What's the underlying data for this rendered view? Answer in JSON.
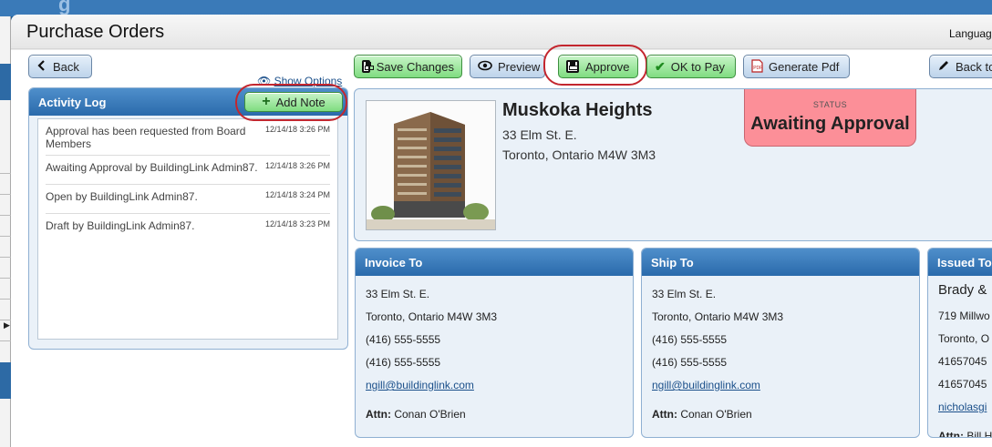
{
  "header": {
    "title": "Purchase Orders",
    "language_label": "Languag"
  },
  "nav": {
    "back_label": "Back",
    "show_options_label": "Show Options"
  },
  "toolbar": {
    "save_label": "Save Changes",
    "preview_label": "Preview",
    "approve_label": "Approve",
    "ok_to_pay_label": "OK to Pay",
    "generate_pdf_label": "Generate Pdf",
    "back_to_label": "Back to"
  },
  "activity_log": {
    "title": "Activity Log",
    "add_note_label": "Add Note",
    "entries": [
      {
        "text": "Approval has been requested from Board Members",
        "time": "12/14/18 3:26 PM"
      },
      {
        "text": "Awaiting Approval by BuildingLink Admin87.",
        "time": "12/14/18 3:26 PM"
      },
      {
        "text": "Open by BuildingLink Admin87.",
        "time": "12/14/18 3:24 PM"
      },
      {
        "text": "Draft by BuildingLink Admin87.",
        "time": "12/14/18 3:23 PM"
      }
    ]
  },
  "property": {
    "name": "Muskoka Heights",
    "address1": "33 Elm St. E.",
    "address2": "Toronto, Ontario M4W 3M3"
  },
  "status": {
    "label": "STATUS",
    "value": "Awaiting Approval",
    "color": "#fc8f98"
  },
  "invoice_to": {
    "title": "Invoice To",
    "address1": "33 Elm St. E.",
    "address2": "Toronto, Ontario M4W 3M3",
    "phone1": "(416) 555-5555",
    "phone2": "(416) 555-5555",
    "email": "ngill@buildinglink.com",
    "attn_label": "Attn:",
    "attn_name": "Conan O'Brien"
  },
  "ship_to": {
    "title": "Ship To",
    "address1": "33 Elm St. E.",
    "address2": "Toronto, Ontario M4W 3M3",
    "phone1": "(416) 555-5555",
    "phone2": "(416) 555-5555",
    "email": "ngill@buildinglink.com",
    "attn_label": "Attn:",
    "attn_name": "Conan O'Brien"
  },
  "issued_to": {
    "title": "Issued To",
    "name": "Brady &",
    "address1": "719 Millwo",
    "address2": "Toronto, O",
    "phone1": "41657045",
    "phone2": "41657045",
    "email": "nicholasgi",
    "attn_label": "Attn:",
    "attn_name": "Bill H"
  },
  "colors": {
    "brand_blue": "#2a6aab",
    "approve_green": "#7fdc80",
    "highlight_red": "#c3262e"
  }
}
